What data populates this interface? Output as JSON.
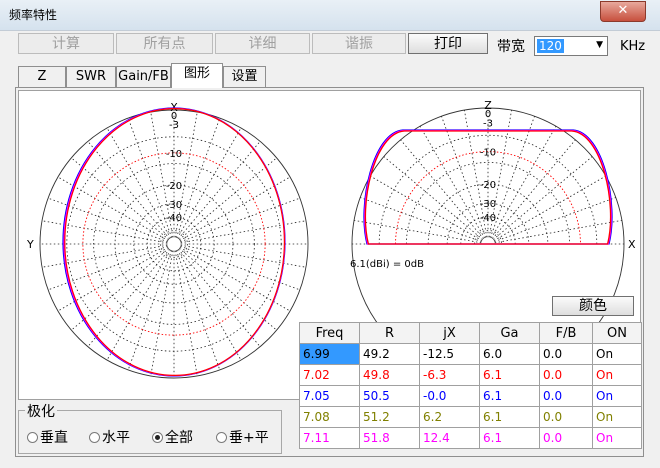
{
  "window": {
    "title": "频率特性",
    "close_glyph": "✕"
  },
  "toolbar": {
    "buttons": [
      {
        "label": "计算",
        "enabled": false
      },
      {
        "label": "所有点",
        "enabled": false
      },
      {
        "label": "详细",
        "enabled": false
      },
      {
        "label": "谐振",
        "enabled": false
      },
      {
        "label": "打印",
        "enabled": true
      }
    ],
    "bandwidth_label": "带宽",
    "bandwidth_value": "120",
    "bandwidth_unit": "KHz"
  },
  "tabs": [
    {
      "label": "Z",
      "selected": false
    },
    {
      "label": "SWR",
      "selected": false
    },
    {
      "label": "Gain/FB",
      "selected": false
    },
    {
      "label": "图形",
      "selected": true
    },
    {
      "label": "设置",
      "selected": false
    }
  ],
  "plot": {
    "left": {
      "axis_labels": {
        "top": "X",
        "left": "Y"
      },
      "ring_labels": [
        "0",
        "-3",
        "-10",
        "-20",
        "-30",
        "-40"
      ]
    },
    "right": {
      "axis_labels": {
        "top": "Z",
        "right": "X"
      },
      "ring_labels": [
        "0",
        "-3",
        "-10",
        "-20",
        "-30",
        "-40"
      ],
      "reference": "6.1(dBi) = 0dB"
    },
    "trace_colors": [
      "#0000ff",
      "#ff00ff",
      "#ff0000"
    ]
  },
  "color_button": "颜色",
  "table": {
    "headers": [
      "Freq",
      "R",
      "jX",
      "Ga",
      "F/B",
      "ON"
    ],
    "rows": [
      {
        "cells": [
          "6.99",
          "49.2",
          "-12.5",
          "6.0",
          "0.0",
          "On"
        ],
        "color": "#000000",
        "selected": true
      },
      {
        "cells": [
          "7.02",
          "49.8",
          "-6.3",
          "6.1",
          "0.0",
          "On"
        ],
        "color": "#ff0000",
        "selected": false
      },
      {
        "cells": [
          "7.05",
          "50.5",
          "-0.0",
          "6.1",
          "0.0",
          "On"
        ],
        "color": "#0000ff",
        "selected": false
      },
      {
        "cells": [
          "7.08",
          "51.2",
          "6.2",
          "6.1",
          "0.0",
          "On"
        ],
        "color": "#808000",
        "selected": false
      },
      {
        "cells": [
          "7.11",
          "51.8",
          "12.4",
          "6.1",
          "0.0",
          "On"
        ],
        "color": "#ff00ff",
        "selected": false
      }
    ]
  },
  "polarization": {
    "label": "极化",
    "options": [
      {
        "label": "垂直",
        "checked": false
      },
      {
        "label": "水平",
        "checked": false
      },
      {
        "label": "全部",
        "checked": true
      },
      {
        "label": "垂+平",
        "checked": false
      }
    ]
  }
}
